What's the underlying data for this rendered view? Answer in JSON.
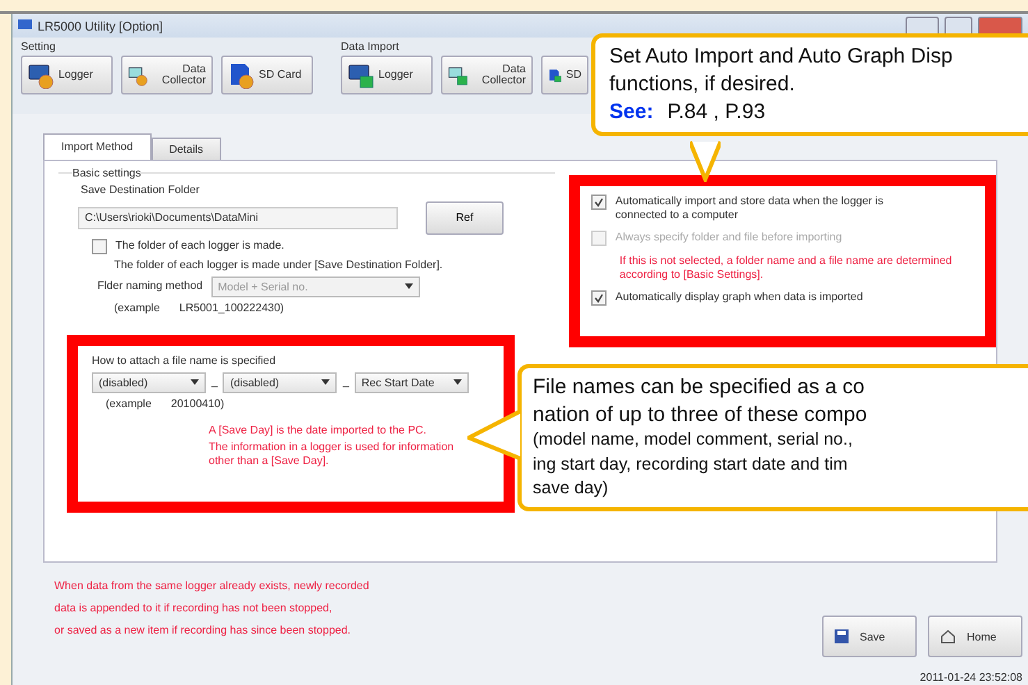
{
  "window": {
    "title": "LR5000 Utility [Option]"
  },
  "toolbar": [
    {
      "label": "Setting",
      "kind": "setting",
      "buttons": [
        {
          "label": "Logger",
          "kind": "logger"
        },
        {
          "label": "Data Collector",
          "kind": "collector"
        },
        {
          "label": "SD Card",
          "kind": "sd"
        }
      ]
    },
    {
      "label": "Data Import",
      "kind": "import",
      "buttons": [
        {
          "label": "Logger",
          "kind": "logger"
        },
        {
          "label": "Data Collector",
          "kind": "collector"
        },
        {
          "label": "SD",
          "kind": "sd"
        }
      ]
    }
  ],
  "tabs": [
    {
      "label": "Import Method",
      "selected": true
    },
    {
      "label": "Details",
      "selected": false
    }
  ],
  "basic_settings": {
    "title": "Basic settings",
    "folder_label": "Save Destination Folder",
    "folder_value": "C:\\Users\\rioki\\Documents\\DataMini",
    "ref_button": "Ref",
    "per_logger": {
      "label": "The folder of each logger is made.",
      "checked": false
    },
    "per_logger_note": "The folder of each logger is made under [Save Destination Folder].",
    "naming_label": "Flder naming method",
    "naming_value": "Model + Serial no.",
    "example_label": "(example",
    "example_value": "LR5001_100222430)"
  },
  "file_name": {
    "title": "How to attach a file name is specified",
    "parts": [
      {
        "value": "(disabled)",
        "separator": "_"
      },
      {
        "value": "(disabled)",
        "separator": "_"
      },
      {
        "value": "Rec Start Date"
      }
    ],
    "example_label": "(example",
    "example_value": "20100410)",
    "notes": [
      "A [Save Day] is the date imported to the PC.",
      "The information in a logger is used for information other than a [Save Day]."
    ]
  },
  "import_options": [
    {
      "kind": "checkbox",
      "label": "Automatically import and store data when the logger is connected to a computer",
      "checked": true,
      "disabled": false
    },
    {
      "kind": "checkbox",
      "label": "Always specify folder and file before importing",
      "checked": false,
      "disabled": true
    },
    {
      "kind": "note",
      "label": "If this is not selected, a folder name and a file name are determined according to [Basic Settings]."
    },
    {
      "kind": "checkbox",
      "label": "Automatically display graph when data is imported",
      "checked": true,
      "disabled": false
    }
  ],
  "footer_notes": [
    "When data from the same logger already exists, newly recorded",
    "data is appended to it if recording has not been stopped,",
    "or saved as a new item if recording has since been stopped."
  ],
  "buttons": [
    {
      "label": "Save",
      "kind": "save"
    },
    {
      "label": "Home",
      "kind": "home"
    }
  ],
  "status_time": "2011-01-24 23:52:08",
  "callouts": [
    {
      "kind": "top",
      "lines": [
        {
          "text": "Set Auto Import and Auto Graph Disp",
          "kind": "large"
        },
        {
          "text": "functions, if desired.",
          "kind": "large"
        }
      ],
      "see_label": "See:",
      "pages": "P.84 , P.93"
    },
    {
      "kind": "left",
      "lines": [
        {
          "text": "File names can be specified as a co",
          "kind": "large"
        },
        {
          "text": "nation of up to three of these compo",
          "kind": "large"
        },
        {
          "text": "(model name, model comment, serial no.,",
          "kind": "small"
        },
        {
          "text": "ing start day, recording start date and tim",
          "kind": "small"
        },
        {
          "text": "save day)",
          "kind": "small"
        }
      ]
    }
  ]
}
